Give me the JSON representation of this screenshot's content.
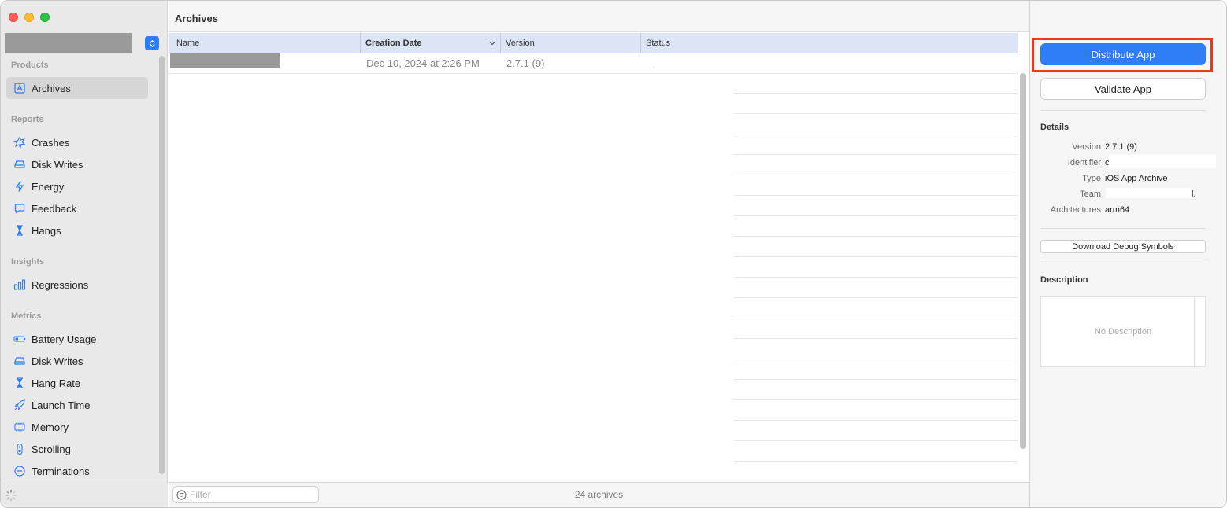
{
  "sidebar": {
    "sections": [
      {
        "title": "Products"
      },
      {
        "title": "Reports"
      },
      {
        "title": "Insights"
      },
      {
        "title": "Metrics"
      }
    ],
    "products": [
      {
        "label": "Archives",
        "icon": "archive-icon"
      }
    ],
    "reports": [
      {
        "label": "Crashes",
        "icon": "crash-burst-icon"
      },
      {
        "label": "Disk Writes",
        "icon": "disk-icon"
      },
      {
        "label": "Energy",
        "icon": "lightning-icon"
      },
      {
        "label": "Feedback",
        "icon": "speech-bubble-icon"
      },
      {
        "label": "Hangs",
        "icon": "hourglass-icon"
      }
    ],
    "insights": [
      {
        "label": "Regressions",
        "icon": "bar-chart-icon"
      }
    ],
    "metrics": [
      {
        "label": "Battery Usage",
        "icon": "battery-icon"
      },
      {
        "label": "Disk Writes",
        "icon": "disk-icon"
      },
      {
        "label": "Hang Rate",
        "icon": "hourglass-icon"
      },
      {
        "label": "Launch Time",
        "icon": "rocket-icon"
      },
      {
        "label": "Memory",
        "icon": "memory-chip-icon"
      },
      {
        "label": "Scrolling",
        "icon": "scroll-icon"
      },
      {
        "label": "Terminations",
        "icon": "minus-circle-icon"
      }
    ]
  },
  "main": {
    "title": "Archives",
    "columns": [
      "Name",
      "Creation Date",
      "Version",
      "Status"
    ],
    "rows": [
      {
        "name": "",
        "creation_date": "Dec 10, 2024 at 2:26 PM",
        "version": "2.7.1 (9)",
        "status": "–"
      }
    ],
    "filter_placeholder": "Filter",
    "count_label": "24 archives"
  },
  "inspector": {
    "distribute_label": "Distribute App",
    "validate_label": "Validate App",
    "details_title": "Details",
    "details": [
      {
        "key": "Version",
        "value": "2.7.1 (9)"
      },
      {
        "key": "Identifier",
        "value": "c"
      },
      {
        "key": "Type",
        "value": "iOS App Archive"
      },
      {
        "key": "Team",
        "value": "l."
      },
      {
        "key": "Architectures",
        "value": "arm64"
      }
    ],
    "download_symbols_label": "Download Debug Symbols",
    "description_title": "Description",
    "description_placeholder": "No Description"
  },
  "colors": {
    "accent": "#2e7cf6",
    "highlight_outline": "#e8391c",
    "header_row": "#dbe5f5",
    "sidebar_bg": "#e9e9e9"
  }
}
